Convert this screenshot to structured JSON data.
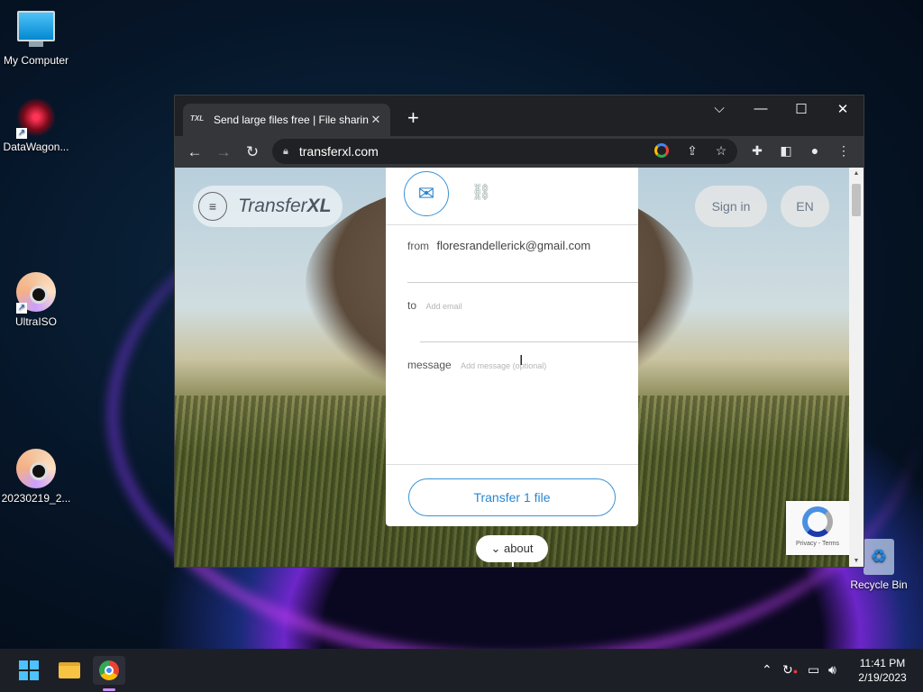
{
  "desktop": {
    "icons": [
      {
        "label": "My Computer"
      },
      {
        "label": "DataWagon..."
      },
      {
        "label": "UltraISO"
      },
      {
        "label": "20230219_2..."
      },
      {
        "label": "Recycle Bin"
      }
    ]
  },
  "browser": {
    "tab": {
      "favicon": "TXL",
      "title": "Send large files free | File sharing",
      "close": "✕"
    },
    "new_tab": "+",
    "controls": {
      "dropdown": "⌵",
      "minimize": "—",
      "maximize": "☐",
      "close": "✕"
    },
    "url": "transferxl.com",
    "nav": {
      "back": "←",
      "forward": "→",
      "reload": "↻"
    }
  },
  "page": {
    "brand": {
      "name": "Transfer",
      "suffix": "XL"
    },
    "menu_icon": "≡",
    "sign_in": "Sign in",
    "language": "EN",
    "form": {
      "from_label": "from",
      "from_value": "floresrandellerick@gmail.com",
      "to_label": "to",
      "to_placeholder": "Add email",
      "message_label": "message",
      "message_placeholder": "Add message (optional)",
      "transfer_button": "Transfer 1 file"
    },
    "about_button": "⌄ about",
    "recaptcha": "Privacy - Terms"
  },
  "taskbar": {
    "time": "11:41 PM",
    "date": "2/19/2023",
    "tray_icons": [
      "chevron-up-icon",
      "sync-icon",
      "network-icon",
      "volume-icon"
    ]
  }
}
